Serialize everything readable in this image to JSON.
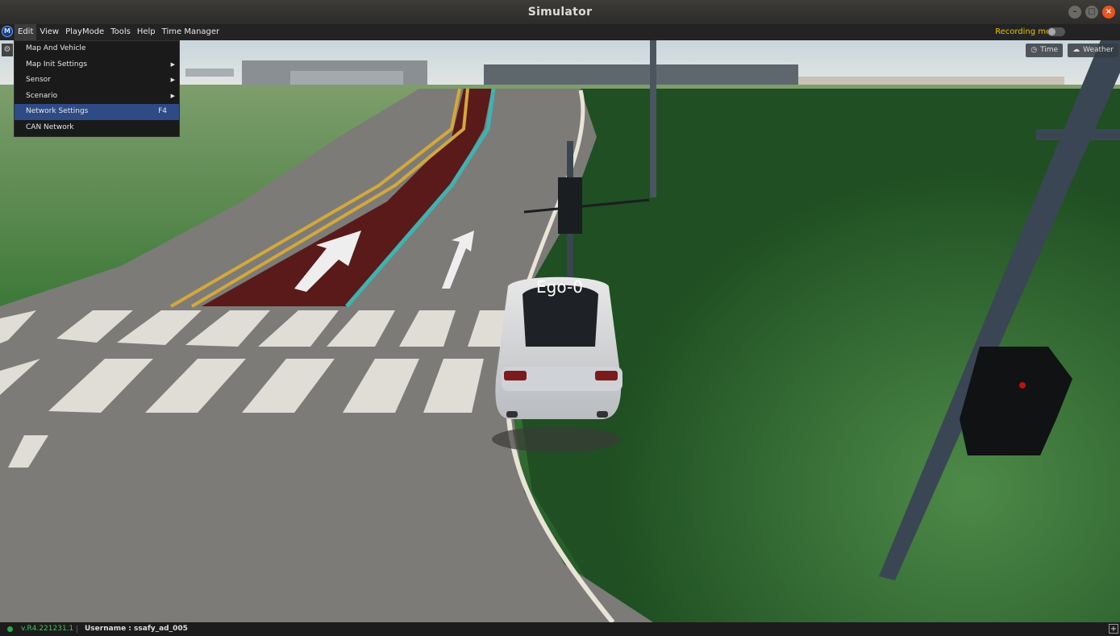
{
  "window": {
    "title": "Simulator"
  },
  "menubar": {
    "items": [
      {
        "label": "Edit"
      },
      {
        "label": "View"
      },
      {
        "label": "PlayMode"
      },
      {
        "label": "Tools"
      },
      {
        "label": "Help"
      },
      {
        "label": "Time Manager"
      }
    ],
    "recording_label": "Recording mode:",
    "recording_on": false
  },
  "edit_menu": {
    "items": [
      {
        "label": "Map And Vehicle",
        "submenu": false,
        "shortcut": ""
      },
      {
        "label": "Map Init Settings",
        "submenu": true,
        "shortcut": ""
      },
      {
        "label": "Sensor",
        "submenu": true,
        "shortcut": ""
      },
      {
        "label": "Scenario",
        "submenu": true,
        "shortcut": ""
      },
      {
        "label": "Network Settings",
        "submenu": false,
        "shortcut": "F4"
      },
      {
        "label": "CAN Network",
        "submenu": false,
        "shortcut": ""
      }
    ]
  },
  "viewport": {
    "vehicle_label": "Ego-0",
    "buttons": {
      "time": "Time",
      "weather": "Weather"
    }
  },
  "statusbar": {
    "version": "v.R4.221231.1",
    "username": "Username : ssafy_ad_005"
  },
  "colors": {
    "accent_selected": "#2e4b86",
    "recording_label": "#e6c200",
    "version_text": "#3ec45e",
    "close_button": "#e95420"
  }
}
